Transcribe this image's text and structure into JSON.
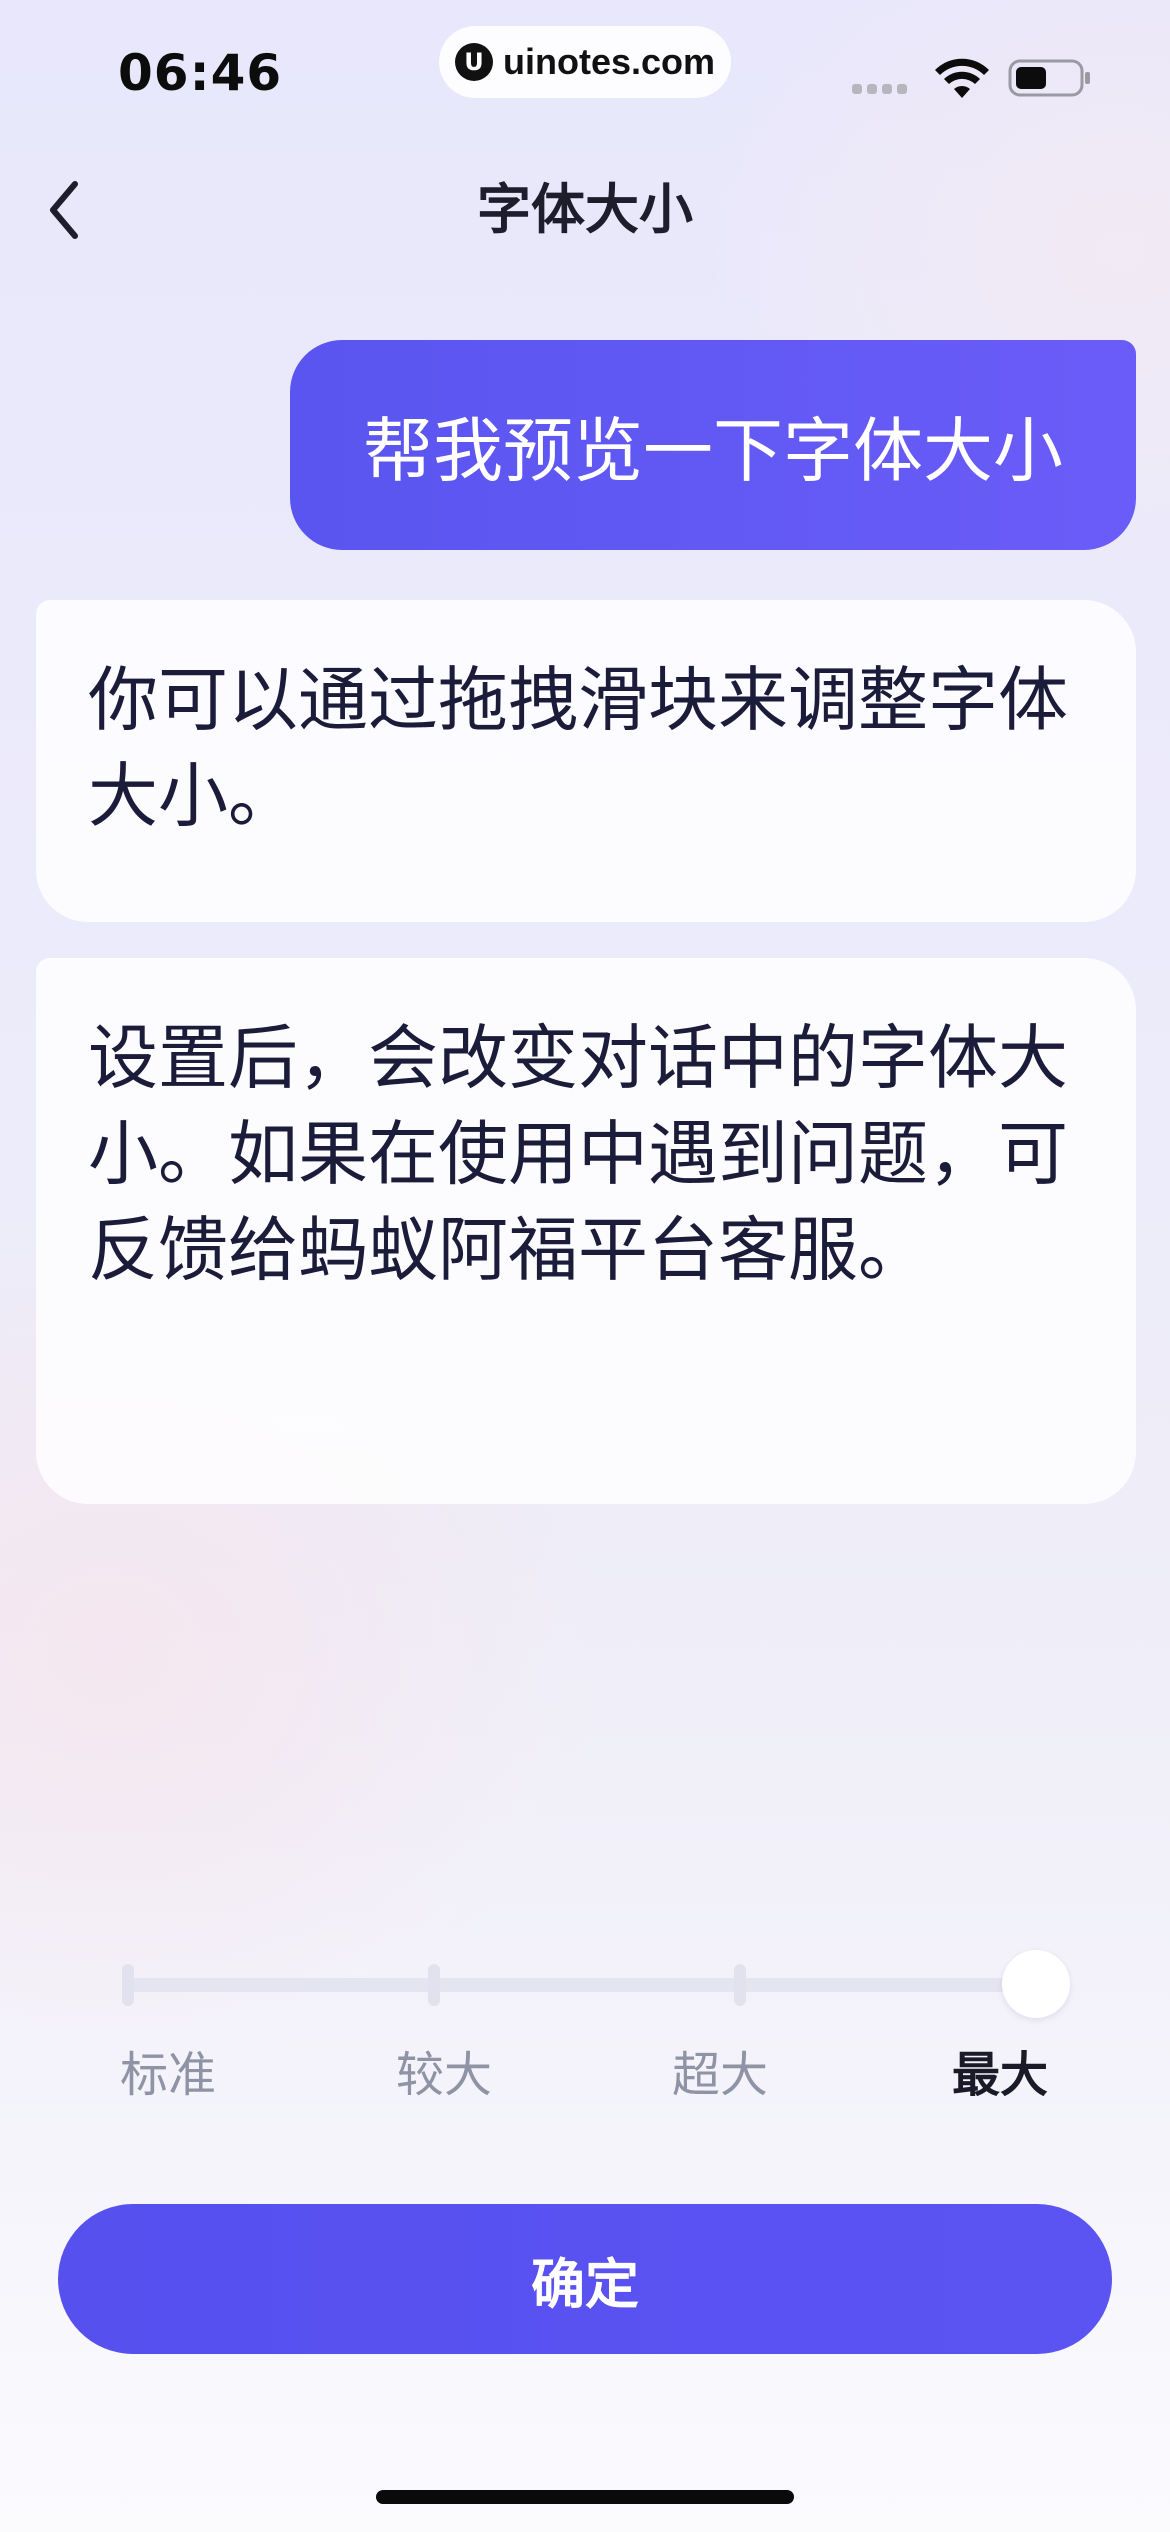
{
  "status_bar": {
    "time": "06:46",
    "url_logo": "U",
    "url": "uinotes.com",
    "icons": [
      "signal-icon",
      "wifi-icon",
      "battery-icon"
    ]
  },
  "nav": {
    "back_icon": "chevron-left-icon",
    "title": "字体大小"
  },
  "chat": {
    "user_message": "帮我预览一下字体大小",
    "bot_messages": [
      "你可以通过拖拽滑块来调整字体大小。",
      "设置后，会改变对话中的字体大小。如果在使用中遇到问题，可反馈给蚂蚁阿福平台客服。"
    ]
  },
  "font_size_slider": {
    "options": [
      "标准",
      "较大",
      "超大",
      "最大"
    ],
    "selected": "最大",
    "selected_index": 3
  },
  "confirm_button": {
    "label": "确定"
  },
  "colors": {
    "accent": "#5a55f0",
    "user_bubble_start": "#5a55f0",
    "user_bubble_end": "#6a5cf8",
    "text_primary": "#1b1b3a",
    "label_inactive": "#8f93a6"
  }
}
